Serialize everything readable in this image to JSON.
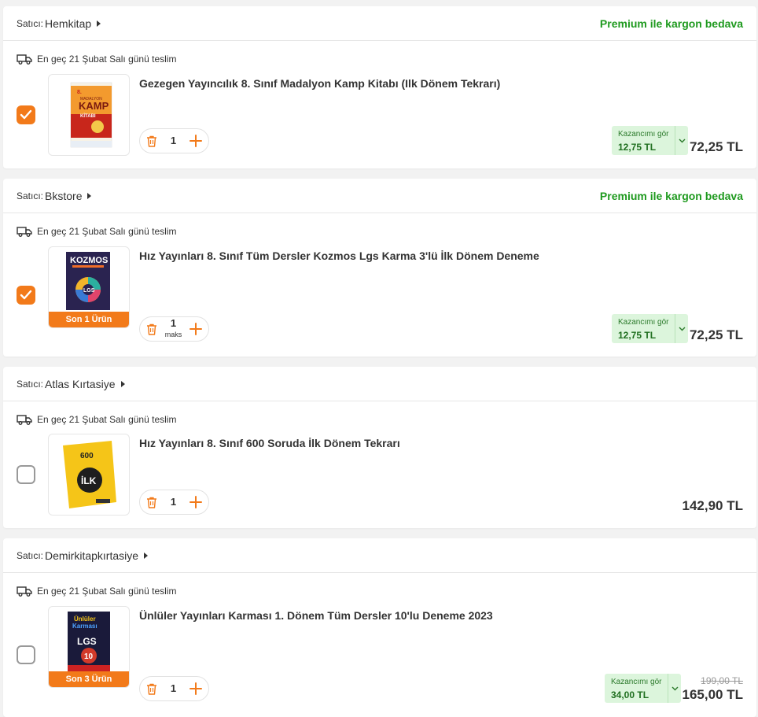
{
  "items": [
    {
      "seller_prefix": "Satıcı:",
      "seller": "Hemkitap",
      "premium": "Premium ile kargon bedava",
      "delivery": "En geç 21 Şubat Salı günü teslim",
      "title": "Gezegen Yayıncılık 8. Sınıf Madalyon Kamp Kitabı (Ilk Dönem Tekrarı)",
      "quantity": "1",
      "earn_label": "Kazancımı gör",
      "earn_value": "12,75 TL",
      "price": "72,25 TL",
      "checked": true,
      "cover_text": [
        "8.",
        "MADALYON",
        "KAMP",
        "KİTABI"
      ]
    },
    {
      "seller_prefix": "Satıcı:",
      "seller": "Bkstore",
      "premium": "Premium ile kargon bedava",
      "delivery": "En geç 21 Şubat Salı günü teslim",
      "title": "Hız Yayınları 8. Sınıf Tüm Dersler Kozmos Lgs Karma 3'lü İlk Dönem Deneme",
      "quantity": "1",
      "qty_note": "maks",
      "stock_badge": "Son 1 Ürün",
      "earn_label": "Kazancımı gör",
      "earn_value": "12,75 TL",
      "price": "72,25 TL",
      "checked": true,
      "cover_text": [
        "KOZMOS",
        "LGS"
      ]
    },
    {
      "seller_prefix": "Satıcı:",
      "seller": "Atlas Kırtasiye",
      "delivery": "En geç 21 Şubat Salı günü teslim",
      "title": "Hız Yayınları 8. Sınıf 600 Soruda İlk Dönem Tekrarı",
      "quantity": "1",
      "price": "142,90 TL",
      "checked": false,
      "cover_text": [
        "600",
        "İLK"
      ]
    },
    {
      "seller_prefix": "Satıcı:",
      "seller": "Demirkitapkırtasiye",
      "delivery": "En geç 21 Şubat Salı günü teslim",
      "title": "Ünlüler Yayınları Karması 1. Dönem Tüm Dersler 10'lu Deneme 2023",
      "quantity": "1",
      "stock_badge": "Son 3 Ürün",
      "earn_label": "Kazancımı gör",
      "earn_value": "34,00 TL",
      "old_price": "199,00 TL",
      "price": "165,00 TL",
      "checked": false,
      "cover_text": [
        "Ünlüler",
        "Karması",
        "LGS",
        "10"
      ]
    }
  ],
  "icons": [
    "truck-icon",
    "check-icon",
    "trash-icon",
    "plus-icon",
    "chevron-down-icon",
    "caret-right-icon"
  ],
  "colors": {
    "accent": "#f27a1a",
    "premium": "#1f9a1f",
    "earn_bg": "#dcf5dc",
    "text": "#333333"
  }
}
